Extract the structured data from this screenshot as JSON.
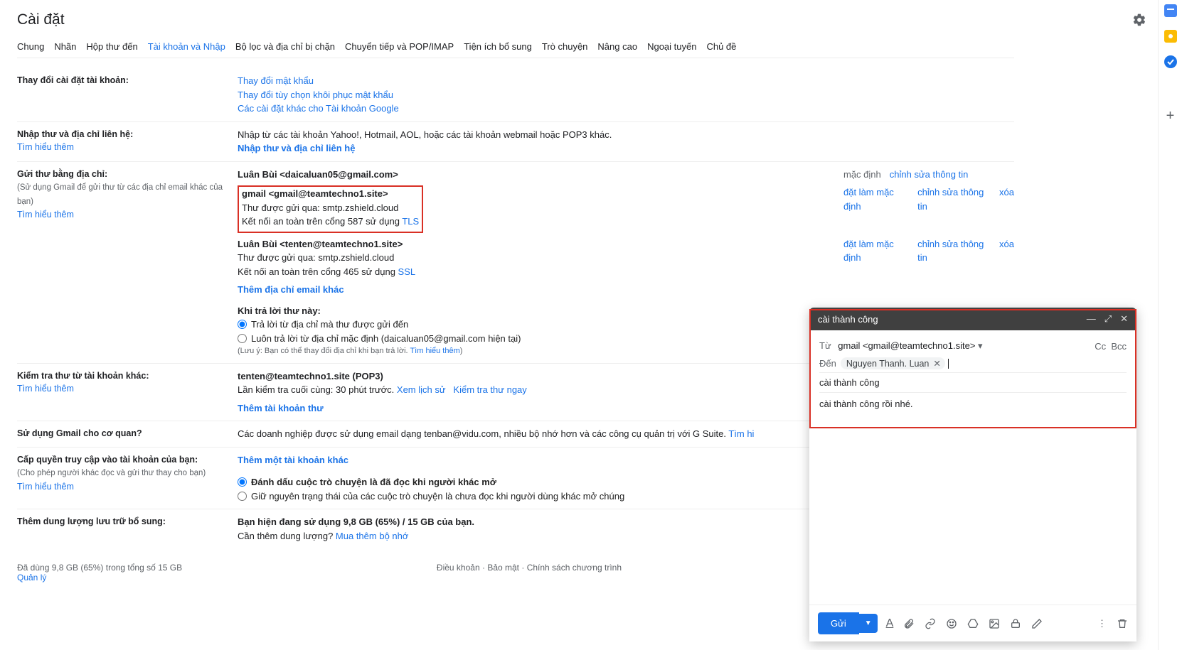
{
  "page_title": "Cài đặt",
  "tabs": [
    "Chung",
    "Nhãn",
    "Hộp thư đến",
    "Tài khoản và Nhập",
    "Bộ lọc và địa chỉ bị chặn",
    "Chuyển tiếp và POP/IMAP",
    "Tiện ích bổ sung",
    "Trò chuyện",
    "Nâng cao",
    "Ngoại tuyến",
    "Chủ đề"
  ],
  "active_tab_index": 3,
  "sections": {
    "change_account": {
      "label": "Thay đổi cài đặt tài khoản:",
      "links": [
        "Thay đổi mật khẩu",
        "Thay đổi tùy chọn khôi phục mật khẩu",
        "Các cài đặt khác cho Tài khoản Google"
      ]
    },
    "import_mail": {
      "label": "Nhập thư và địa chỉ liên hệ:",
      "learn_more": "Tìm hiểu thêm",
      "desc": "Nhập từ các tài khoản Yahoo!, Hotmail, AOL, hoặc các tài khoản webmail hoặc POP3 khác.",
      "action": "Nhập thư và địa chỉ liên hệ"
    },
    "send_as": {
      "label": "Gửi thư bằng địa chỉ:",
      "sub": "(Sử dụng Gmail để gửi thư từ các địa chỉ email khác của bạn)",
      "learn_more": "Tìm hiểu thêm",
      "rows": [
        {
          "name": "Luân Bùi <daicaluan05@gmail.com>",
          "smtp": "",
          "port_line": "",
          "default_label": "mặc định",
          "edit": "chỉnh sửa thông tin",
          "delete": ""
        },
        {
          "name": "gmail <gmail@teamtechno1.site>",
          "smtp": "Thư được gửi qua: smtp.zshield.cloud",
          "port_line_prefix": "Kết nối an toàn trên cổng 587 sử dụng ",
          "port_proto": "TLS",
          "default_label": "đặt làm mặc định",
          "edit": "chỉnh sửa thông tin",
          "delete": "xóa"
        },
        {
          "name": "Luân Bùi <tenten@teamtechno1.site>",
          "smtp": "Thư được gửi qua: smtp.zshield.cloud",
          "port_line_prefix": "Kết nối an toàn trên cổng 465 sử dụng ",
          "port_proto": "SSL",
          "default_label": "đặt làm mặc định",
          "edit": "chỉnh sửa thông tin",
          "delete": "xóa"
        }
      ],
      "add_another": "Thêm địa chỉ email khác",
      "reply_heading": "Khi trả lời thư này:",
      "reply_opt1": "Trả lời từ địa chỉ mà thư được gửi đến",
      "reply_opt2": "Luôn trả lời từ địa chỉ mặc định (daicaluan05@gmail.com hiện tại)",
      "reply_note_prefix": "(Lưu ý: Bạn có thể thay đổi địa chỉ khi bạn trả lời. ",
      "reply_note_link": "Tìm hiểu thêm",
      "reply_note_suffix": ")"
    },
    "check_mail": {
      "label": "Kiểm tra thư từ tài khoản khác:",
      "learn_more": "Tìm hiểu thêm",
      "account": "tenten@teamtechno1.site (POP3)",
      "last_check_prefix": "Lần kiểm tra cuối cùng: 30 phút trước. ",
      "history": "Xem lịch sử",
      "check_now": "Kiểm tra thư ngay",
      "add_account": "Thêm tài khoản thư"
    },
    "biz": {
      "label": "Sử dụng Gmail cho cơ quan?",
      "desc": "Các doanh nghiệp được sử dụng email dạng tenban@vidu.com, nhiều bộ nhớ hơn và các công cụ quản trị với G Suite. ",
      "learn_more": "Tìm hi"
    },
    "grant_access": {
      "label": "Cấp quyền truy cập vào tài khoản của bạn:",
      "sub": "(Cho phép người khác đọc và gửi thư thay cho bạn)",
      "learn_more": "Tìm hiểu thêm",
      "add": "Thêm một tài khoản khác",
      "opt1": "Đánh dấu cuộc trò chuyện là đã đọc khi người khác mở",
      "opt2": "Giữ nguyên trạng thái của các cuộc trò chuyện là chưa đọc khi người dùng khác mở chúng"
    },
    "storage": {
      "label": "Thêm dung lượng lưu trữ bổ sung:",
      "usage": "Bạn hiện đang sử dụng 9,8 GB (65%) / 15 GB của bạn.",
      "need_more": "Cần thêm dung lượng? ",
      "buy": "Mua thêm bộ nhớ"
    }
  },
  "footer": {
    "usage": "Đã dùng 9,8 GB (65%) trong tổng số 15 GB",
    "manage": "Quản lý",
    "terms": "Điều khoản",
    "privacy": "Bảo mật",
    "policies": "Chính sách chương trình"
  },
  "compose": {
    "title": "cài thành công",
    "from_label": "Từ",
    "from_value": "gmail <gmail@teamtechno1.site>",
    "to_label": "Đến",
    "to_chip": "Nguyen Thanh. Luan",
    "cc": "Cc",
    "bcc": "Bcc",
    "subject": "cài thành công",
    "body": "cài thành công rồi nhé.",
    "send": "Gửi"
  }
}
